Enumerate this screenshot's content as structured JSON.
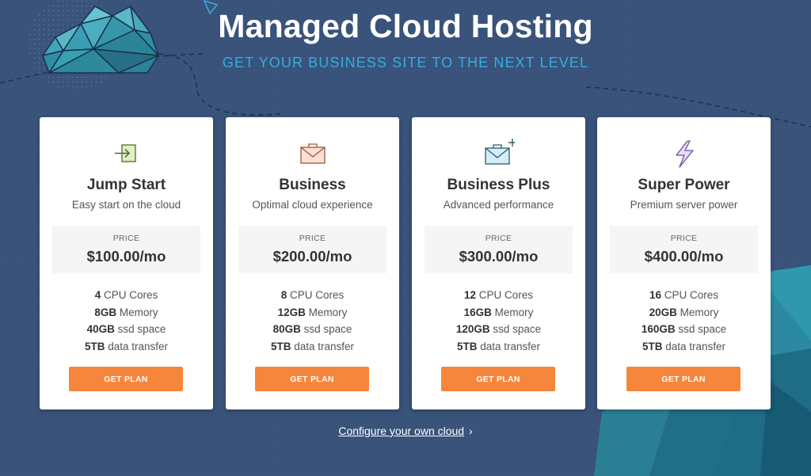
{
  "hero": {
    "title": "Managed Cloud Hosting",
    "subtitle": "GET YOUR BUSINESS SITE TO THE NEXT LEVEL"
  },
  "colors": {
    "background": "#3a5377",
    "accent": "#33aee0",
    "button": "#f5863c",
    "card": "#ffffff"
  },
  "plans": [
    {
      "icon": "arrow-into-box-icon",
      "name": "Jump Start",
      "tagline": "Easy start on the cloud",
      "price_label": "PRICE",
      "price": "$100.00/mo",
      "features": [
        {
          "value": "4",
          "label": "CPU Cores"
        },
        {
          "value": "8GB",
          "label": "Memory"
        },
        {
          "value": "40GB",
          "label": "ssd space"
        },
        {
          "value": "5TB",
          "label": "data transfer"
        }
      ],
      "button": "GET PLAN"
    },
    {
      "icon": "briefcase-envelope-icon",
      "name": "Business",
      "tagline": "Optimal cloud experience",
      "price_label": "PRICE",
      "price": "$200.00/mo",
      "features": [
        {
          "value": "8",
          "label": "CPU Cores"
        },
        {
          "value": "12GB",
          "label": "Memory"
        },
        {
          "value": "80GB",
          "label": "ssd space"
        },
        {
          "value": "5TB",
          "label": "data transfer"
        }
      ],
      "button": "GET PLAN"
    },
    {
      "icon": "briefcase-plus-icon",
      "name": "Business Plus",
      "tagline": "Advanced performance",
      "price_label": "PRICE",
      "price": "$300.00/mo",
      "features": [
        {
          "value": "12",
          "label": "CPU Cores"
        },
        {
          "value": "16GB",
          "label": "Memory"
        },
        {
          "value": "120GB",
          "label": "ssd space"
        },
        {
          "value": "5TB",
          "label": "data transfer"
        }
      ],
      "button": "GET PLAN"
    },
    {
      "icon": "lightning-bolt-icon",
      "name": "Super Power",
      "tagline": "Premium server power",
      "price_label": "PRICE",
      "price": "$400.00/mo",
      "features": [
        {
          "value": "16",
          "label": "CPU Cores"
        },
        {
          "value": "20GB",
          "label": "Memory"
        },
        {
          "value": "160GB",
          "label": "ssd space"
        },
        {
          "value": "5TB",
          "label": "data transfer"
        }
      ],
      "button": "GET PLAN"
    }
  ],
  "configure": {
    "label": "Configure your own cloud",
    "chevron": "›"
  }
}
